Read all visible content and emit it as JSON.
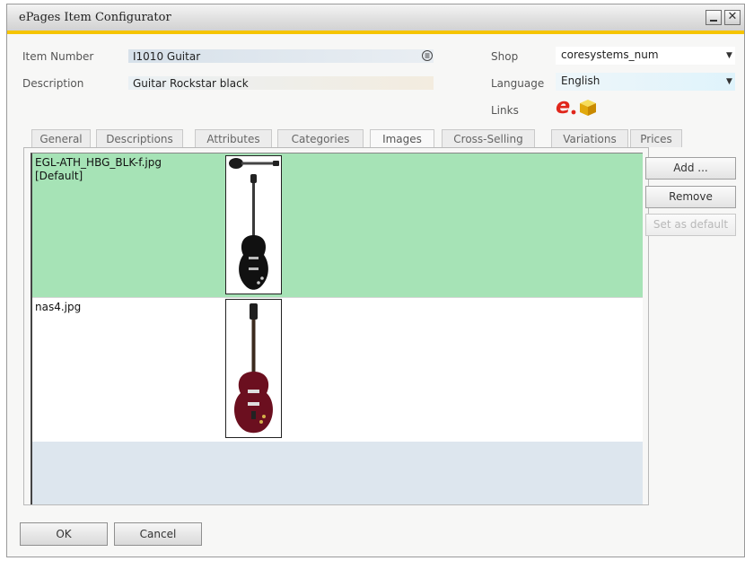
{
  "window": {
    "title": "ePages Item Configurator"
  },
  "form": {
    "item_number_label": "Item Number",
    "item_number_value": "I1010 Guitar",
    "description_label": "Description",
    "description_value": "Guitar Rockstar black",
    "shop_label": "Shop",
    "shop_value": "coresystems_num",
    "language_label": "Language",
    "language_value": "English",
    "links_label": "Links"
  },
  "tabs": [
    "General",
    "Descriptions",
    "Attributes",
    "Categories",
    "Images",
    "Cross-Selling",
    "Variations",
    "Prices"
  ],
  "active_tab": "Images",
  "images": [
    {
      "filename": "EGL-ATH_HBG_BLK-f.jpg",
      "tag": "[Default]"
    },
    {
      "filename": "nas4.jpg",
      "tag": ""
    }
  ],
  "side_buttons": {
    "add": "Add ...",
    "remove": "Remove",
    "set_default": "Set as default"
  },
  "footer": {
    "ok": "OK",
    "cancel": "Cancel"
  },
  "colors": {
    "accent": "#f5c400",
    "selected_row": "#a6e3b6",
    "list_bg": "#dde6ee"
  },
  "icons": [
    "epages-logo-icon",
    "cube-icon",
    "list-icon"
  ]
}
